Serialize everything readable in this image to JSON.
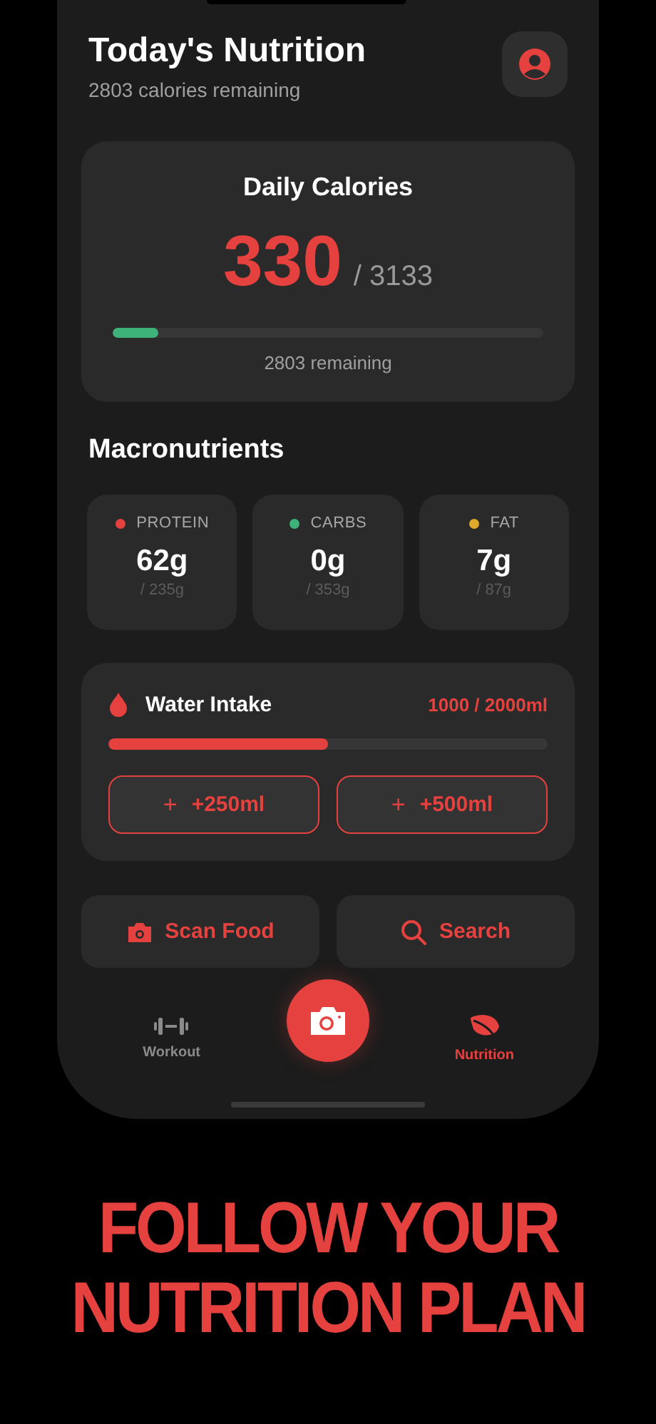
{
  "header": {
    "title": "Today's Nutrition",
    "subtitle": "2803 calories remaining"
  },
  "calories": {
    "title": "Daily Calories",
    "consumed": "330",
    "goal": "/ 3133",
    "level": 0.105,
    "remaining": "2803 remaining"
  },
  "macros": {
    "title": "Macronutrients",
    "items": [
      {
        "name": "PROTEIN",
        "color": "#e5413f",
        "amount": "62g",
        "goal": "/ 235g"
      },
      {
        "name": "CARBS",
        "color": "#3db37a",
        "amount": "0g",
        "goal": "/ 353g"
      },
      {
        "name": "FAT",
        "color": "#e0a92a",
        "amount": "7g",
        "goal": "/ 87g"
      }
    ]
  },
  "water": {
    "title": "Water Intake",
    "reading": "1000 / 2000ml",
    "level": 0.5,
    "buttons": [
      {
        "icon": "+",
        "label": "+250ml"
      },
      {
        "icon": "+",
        "label": "+500ml"
      }
    ]
  },
  "actions": [
    {
      "kind": "camera",
      "label": "Scan Food"
    },
    {
      "kind": "search",
      "label": "Search"
    }
  ],
  "tabs": [
    {
      "kind": "dumbbell",
      "label": "Workout",
      "selected": false
    },
    {
      "kind": "leaf",
      "label": "Nutrition",
      "selected": true
    }
  ],
  "caption": [
    "FOLLOW YOUR",
    "NUTRITION PLAN"
  ]
}
